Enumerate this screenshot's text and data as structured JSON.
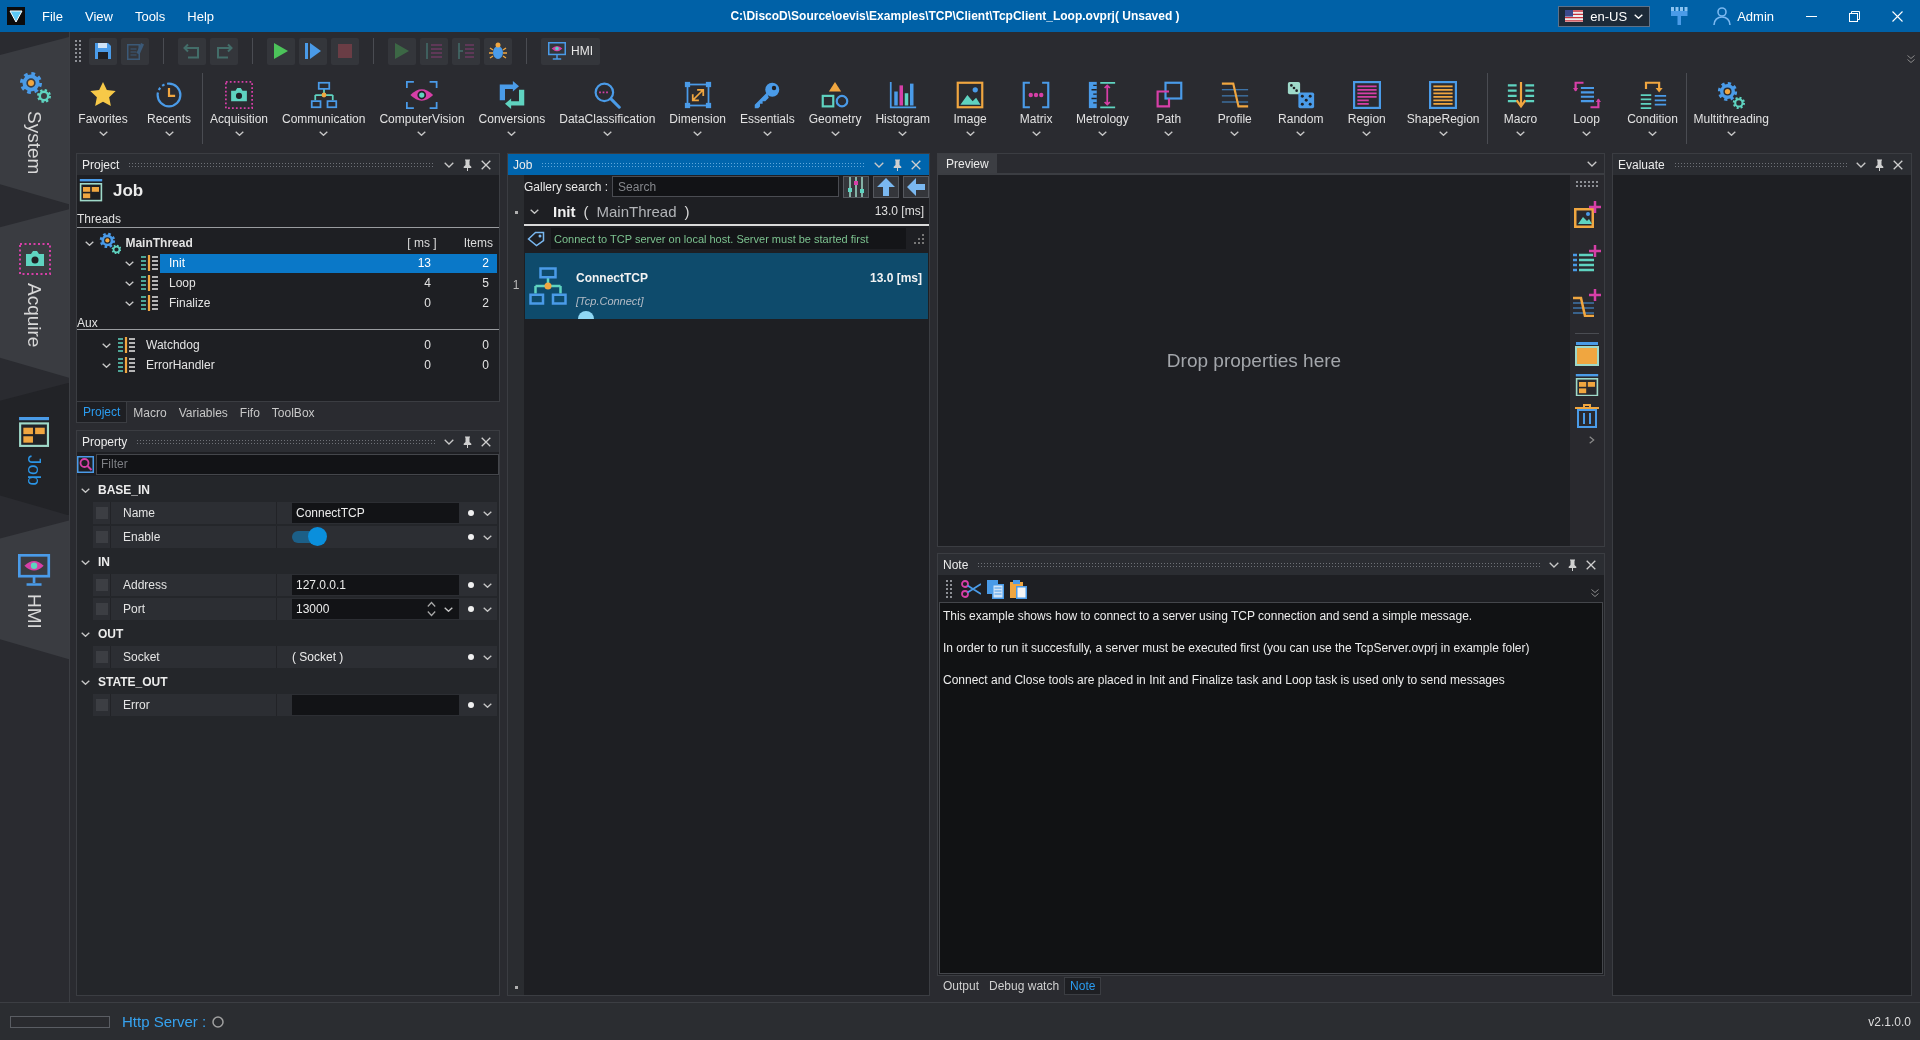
{
  "title_bar": {
    "menu": [
      "File",
      "View",
      "Tools",
      "Help"
    ],
    "title": "C:\\DiscoD\\Source\\oevis\\Examples\\TCP\\Client\\TcpClient_Loop.ovprj( Unsaved )",
    "language": "en-US",
    "user": "Admin"
  },
  "side_tabs": [
    {
      "label": "System",
      "selected": false
    },
    {
      "label": "Acquire",
      "selected": false
    },
    {
      "label": "Job",
      "selected": true
    },
    {
      "label": "HMI",
      "selected": false
    }
  ],
  "quick_toolbar": {
    "buttons": [
      {
        "disabled": false
      },
      {
        "disabled": true
      },
      {
        "disabled": true
      },
      {
        "disabled": true
      },
      {
        "disabled": false
      },
      {
        "disabled": false
      },
      {
        "disabled": true
      },
      {
        "disabled": true
      },
      {
        "disabled": true
      },
      {
        "disabled": true
      },
      {
        "disabled": false
      }
    ],
    "hmi_button": "HMI"
  },
  "ribbon": {
    "groups": [
      {
        "items": [
          "Favorites",
          "Recents"
        ]
      },
      {
        "items": [
          "Acquisition",
          "Communication",
          "ComputerVision",
          "Conversions",
          "DataClassification",
          "Dimension",
          "Essentials",
          "Geometry",
          "Histogram",
          "Image",
          "Matrix",
          "Metrology",
          "Path",
          "Profile",
          "Random",
          "Region",
          "ShapeRegion"
        ]
      },
      {
        "items": [
          "Macro",
          "Loop",
          "Condition"
        ]
      },
      {
        "items": [
          "Multithreading"
        ]
      }
    ]
  },
  "project_panel": {
    "title": "Project",
    "active": false,
    "heading": "Job",
    "threads": {
      "label": "Threads",
      "root": {
        "name": "MainThread",
        "expanded": true,
        "time_header": "[ ms ]",
        "items_header": "Items",
        "children": [
          {
            "name": "Init",
            "time": "13",
            "items": "2",
            "expanded": true,
            "selected": true
          },
          {
            "name": "Loop",
            "time": "4",
            "items": "5",
            "expanded": true,
            "selected": false
          },
          {
            "name": "Finalize",
            "time": "0",
            "items": "2",
            "expanded": true,
            "selected": false
          }
        ]
      }
    },
    "aux": {
      "label": "Aux",
      "tasks": [
        {
          "name": "Watchdog",
          "time": "0",
          "items": "0",
          "expanded": true,
          "selected": false
        },
        {
          "name": "ErrorHandler",
          "time": "0",
          "items": "0",
          "expanded": true,
          "selected": false
        }
      ]
    },
    "tabs": [
      {
        "label": "Project",
        "selected": true
      },
      {
        "label": "Macro",
        "selected": false
      },
      {
        "label": "Variables",
        "selected": false
      },
      {
        "label": "Fifo",
        "selected": false
      },
      {
        "label": "ToolBox",
        "selected": false
      }
    ]
  },
  "property_panel": {
    "title": "Property",
    "active": false,
    "filter": {
      "placeholder": "Filter"
    },
    "groups": [
      {
        "name": "BASE_IN",
        "expanded": true,
        "rows": [
          {
            "label": "Name",
            "kind": "text",
            "value": "ConnectTCP",
            "checked": false
          },
          {
            "label": "Enable",
            "kind": "toggle",
            "on": true,
            "checked": false
          }
        ]
      },
      {
        "name": "IN",
        "expanded": true,
        "rows": [
          {
            "label": "Address",
            "kind": "text",
            "value": "127.0.0.1",
            "checked": false
          },
          {
            "label": "Port",
            "kind": "number",
            "value": "13000",
            "checked": false
          }
        ]
      },
      {
        "name": "OUT",
        "expanded": true,
        "rows": [
          {
            "label": "Socket",
            "kind": "readonly",
            "value": "( Socket )",
            "checked": false
          }
        ]
      },
      {
        "name": "STATE_OUT",
        "expanded": true,
        "rows": [
          {
            "label": "Error",
            "kind": "text",
            "checked": false
          }
        ]
      }
    ]
  },
  "job_panel": {
    "title": "Job",
    "active": true,
    "gallery_search": {
      "label": "Gallery search :",
      "placeholder": "Search"
    },
    "task": {
      "name": "Init",
      "open_paren": "(",
      "thread": "MainThread",
      "close_paren": ")",
      "time": "13.0 [ms]",
      "expanded": true
    },
    "comment": "Connect to TCP server on local host. Server must be started first",
    "tools": [
      {
        "line": "1",
        "name": "ConnectTCP",
        "type": "[Tcp.Connect]",
        "time": "13.0 [ms]",
        "selected": true
      }
    ]
  },
  "preview_panel": {
    "title": "Preview",
    "message": "Drop properties here"
  },
  "note_panel": {
    "title": "Note",
    "active": false,
    "paragraphs": [
      "This example shows how to connect to a server using TCP connection and send a simple message.",
      "In order to run it succesfully, a server must be executed first (you can use the TcpServer.ovprj in example foler)",
      "Connect and Close tools are placed in Init and Finalize task and Loop task is used only to send messages"
    ]
  },
  "bottom_tabs": [
    {
      "label": "Output",
      "selected": false
    },
    {
      "label": "Debug watch",
      "selected": false
    },
    {
      "label": "Note",
      "selected": true
    }
  ],
  "evaluate_panel": {
    "title": "Evaluate",
    "active": false
  },
  "status_bar": {
    "http_label": "Http Server :",
    "connected": false,
    "version": "v2.1.0.0"
  }
}
